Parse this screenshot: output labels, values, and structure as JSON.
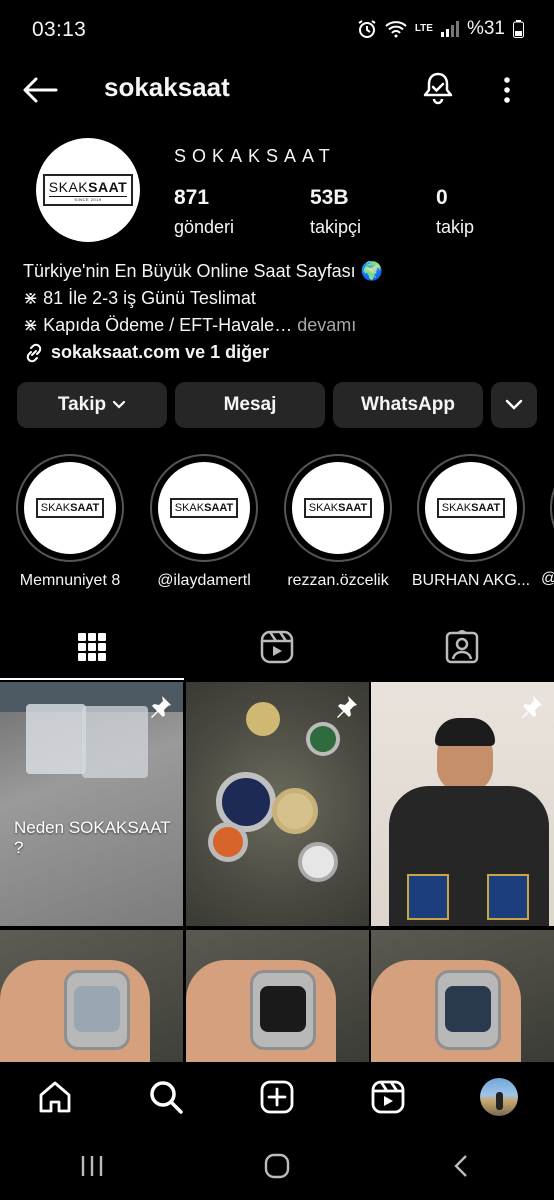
{
  "status_bar": {
    "time": "03:13",
    "battery": "%31",
    "network": "LTE"
  },
  "header": {
    "handle": "sokaksaat"
  },
  "profile": {
    "display_name": "SOKAKSAAT",
    "logo_text_a": "S",
    "logo_text_b": "KAK",
    "logo_text_c": "SAAT",
    "logo_since": "SINCE 2019",
    "stats": {
      "posts": {
        "value": "871",
        "label": "gönderi"
      },
      "followers": {
        "value": "53B",
        "label": "takipçi"
      },
      "following": {
        "value": "0",
        "label": "takip"
      }
    },
    "bio": {
      "line1": "Türkiye'nin En Büyük Online Saat Sayfası 🌍",
      "line2": "⋇ 81 İle 2-3 iş Günü Teslimat",
      "line3": "⋇ Kapıda Ödeme / EFT-Havale…",
      "more": " devamı",
      "link": "sokaksaat.com ve 1 diğer"
    }
  },
  "buttons": {
    "follow": "Takip",
    "message": "Mesaj",
    "whatsapp": "WhatsApp"
  },
  "highlights": [
    {
      "label": "Memnuniyet 8"
    },
    {
      "label": "@ilaydamertl"
    },
    {
      "label": "rezzan.özcelik"
    },
    {
      "label": "BURHAN AKG..."
    }
  ],
  "highlight_peek": {
    "label": "@"
  },
  "grid": {
    "caption_1": "Neden SOKAKSAAT ?"
  },
  "colors": {
    "background": "#000000",
    "button": "#262626",
    "muted_text": "#a8a8a8"
  },
  "icons": {
    "back": "arrow-left-icon",
    "notifications": "bell-check-icon",
    "more": "more-vertical-icon",
    "grid": "grid-icon",
    "reels": "reels-icon",
    "tagged": "tagged-icon",
    "home": "home-icon",
    "search": "search-icon",
    "create": "plus-square-icon",
    "pin": "pin-icon"
  }
}
